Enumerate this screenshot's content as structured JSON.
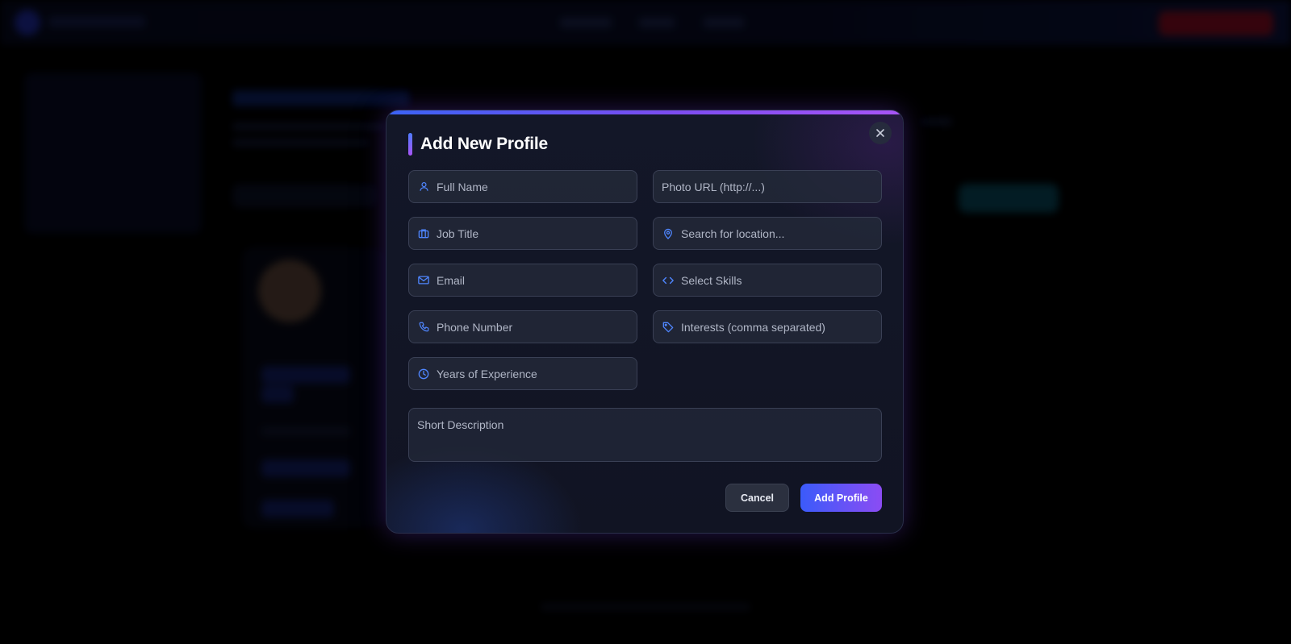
{
  "modal": {
    "title": "Add New Profile",
    "fields": {
      "full_name": {
        "placeholder": "Full Name",
        "icon": "user-icon"
      },
      "photo_url": {
        "placeholder": "Photo URL (http://...)"
      },
      "job_title": {
        "placeholder": "Job Title",
        "icon": "briefcase-icon"
      },
      "location": {
        "placeholder": "Search for location...",
        "icon": "map-pin-icon"
      },
      "email": {
        "placeholder": "Email",
        "icon": "mail-icon"
      },
      "skills": {
        "placeholder": "Select Skills",
        "icon": "code-icon"
      },
      "phone": {
        "placeholder": "Phone Number",
        "icon": "phone-icon"
      },
      "interests": {
        "placeholder": "Interests (comma separated)",
        "icon": "tag-icon"
      },
      "experience": {
        "placeholder": "Years of Experience",
        "icon": "clock-icon"
      },
      "description": {
        "placeholder": "Short Description"
      }
    },
    "buttons": {
      "cancel": "Cancel",
      "add": "Add Profile",
      "close_icon": "close-icon"
    }
  },
  "colors": {
    "accent_blue": "#3b5bfa",
    "accent_purple": "#a855f7",
    "icon_blue": "#4f86ff",
    "background": "#000000"
  }
}
